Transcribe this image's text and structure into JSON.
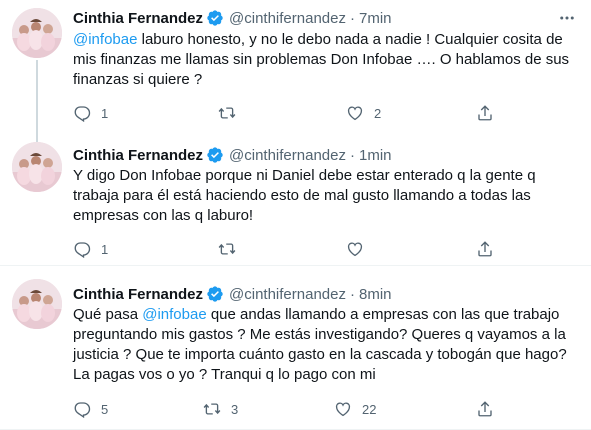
{
  "tweets": [
    {
      "name": "Cinthia Fernandez",
      "handle": "@cinthifernandez",
      "dot": "·",
      "time": "7min",
      "mention": "@infobae",
      "text_after_mention": " laburo honesto, y no le debo nada a nadie ! Cualquier cosita de mis finanzas me llamas sin problemas Don Infobae …. O hablamos de sus finanzas si quiere ?",
      "replies": "1",
      "retweets": "",
      "likes": "2"
    },
    {
      "name": "Cinthia Fernandez",
      "handle": "@cinthifernandez",
      "dot": "·",
      "time": "1min",
      "text": "Y digo Don Infobae porque ni Daniel debe estar enterado q la gente q trabaja para él está haciendo esto de mal gusto llamando a todas las empresas con las q laburo!",
      "replies": "1",
      "retweets": "",
      "likes": ""
    },
    {
      "name": "Cinthia Fernandez",
      "handle": "@cinthifernandez",
      "dot": "·",
      "time": "8min",
      "text_before_mention": "Qué pasa ",
      "mention": "@infobae",
      "text_after_mention": " que andas llamando a empresas con las que trabajo preguntando mis gastos ? Me estás investigando? Queres q vayamos a la justicia ? Que te importa cuánto gasto en la cascada y tobogán que hago? La pagas vos o yo ? Tranqui q lo pago con mi",
      "replies": "5",
      "retweets": "3",
      "likes": "22"
    }
  ],
  "icons": {
    "verified": "verified-badge-icon",
    "more": "more-icon",
    "reply": "reply-icon",
    "retweet": "retweet-icon",
    "like": "like-icon",
    "share": "share-icon"
  },
  "colors": {
    "text": "#0f1419",
    "secondary": "#536471",
    "accent": "#1d9bf0",
    "divider": "#eff3f4",
    "thread_line": "#cfd9de"
  }
}
